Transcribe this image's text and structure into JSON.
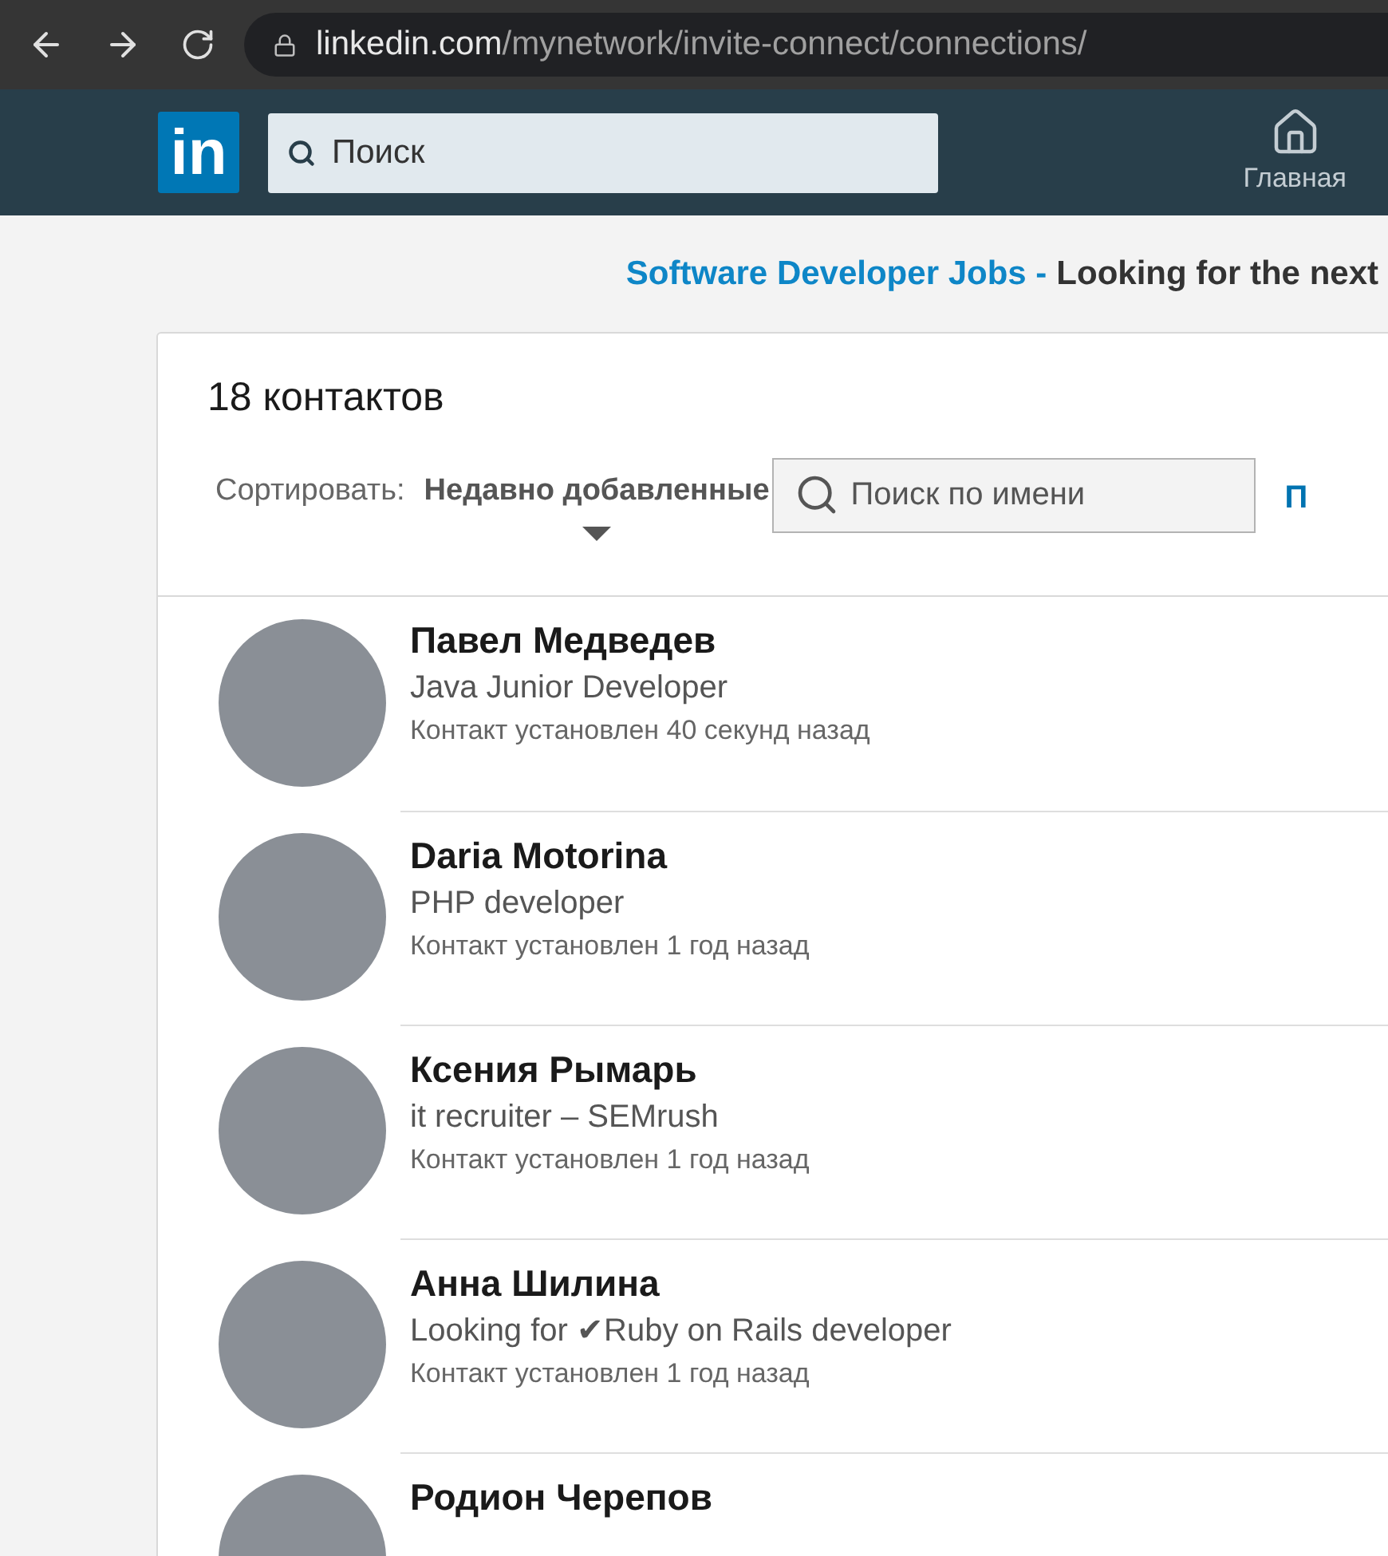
{
  "browser": {
    "url_domain": "linkedin.com",
    "url_path": "/mynetwork/invite-connect/connections/"
  },
  "header": {
    "logo": "in",
    "search": {
      "placeholder": "Поиск"
    },
    "nav": [
      {
        "label": "Главная",
        "selected": false
      }
    ]
  },
  "ad": {
    "link": "Software Developer Jobs -",
    "text": "Looking for the next"
  },
  "connections": {
    "title": "18 контактов",
    "sort_label": "Сортировать:",
    "sort_value": "Недавно добавленные",
    "search": {
      "placeholder": "Поиск по имени"
    },
    "link": "П",
    "items": [
      {
        "name": "Павел Медведев",
        "headline": "Java Junior Developer",
        "connected": "Контакт установлен 40 секунд назад"
      },
      {
        "name": "Daria Motorina",
        "headline": "PHP developer",
        "connected": "Контакт установлен 1 год назад"
      },
      {
        "name": "Ксения Рымарь",
        "headline": "it recruiter – SEMrush",
        "connected": "Контакт установлен 1 год назад"
      },
      {
        "name": "Анна Шилина",
        "headline": "Looking for ✔Ruby on Rails developer",
        "connected": "Контакт установлен 1 год назад"
      },
      {
        "name": "Родион Черепов"
      }
    ]
  }
}
